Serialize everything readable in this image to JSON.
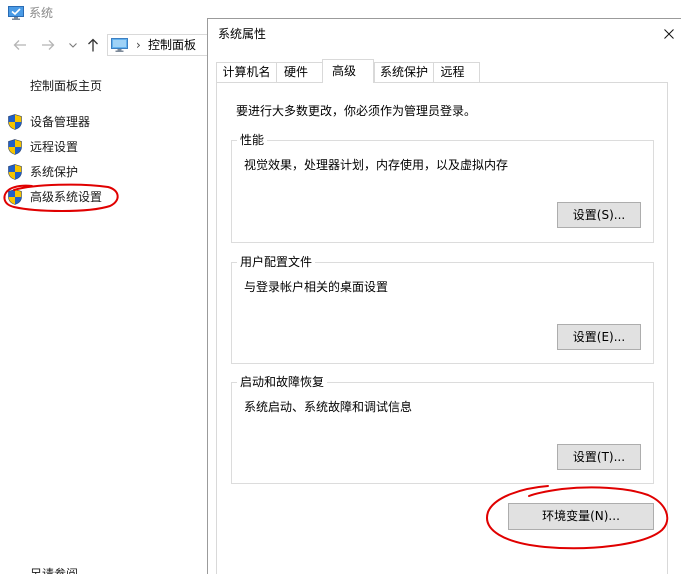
{
  "background_window": {
    "title": "系统",
    "title_icon": "system-monitor-icon",
    "nav": {
      "back_icon": "arrow-left-icon",
      "forward_icon": "arrow-right-icon",
      "recent_icon": "chevron-down-icon",
      "up_icon": "arrow-up-icon"
    },
    "address": {
      "location_icon": "computer-icon",
      "separator": "›",
      "crumb": "控制面板"
    },
    "sidebar": {
      "home_link": "控制面板主页",
      "items": [
        {
          "label": "设备管理器",
          "icon": "uac-shield-icon"
        },
        {
          "label": "远程设置",
          "icon": "uac-shield-icon"
        },
        {
          "label": "系统保护",
          "icon": "uac-shield-icon"
        },
        {
          "label": "高级系统设置",
          "icon": "uac-shield-icon"
        }
      ],
      "see_also": "另请参阅"
    }
  },
  "dialog": {
    "title": "系统属性",
    "close_icon": "close-icon",
    "tabs": [
      {
        "label": "计算机名",
        "selected": false
      },
      {
        "label": "硬件",
        "selected": false
      },
      {
        "label": "高级",
        "selected": true
      },
      {
        "label": "系统保护",
        "selected": false
      },
      {
        "label": "远程",
        "selected": false
      }
    ],
    "advanced": {
      "admin_note": "要进行大多数更改，你必须作为管理员登录。",
      "groups": [
        {
          "title": "性能",
          "description": "视觉效果，处理器计划，内存使用，以及虚拟内存",
          "button": "设置(S)..."
        },
        {
          "title": "用户配置文件",
          "description": "与登录帐户相关的桌面设置",
          "button": "设置(E)..."
        },
        {
          "title": "启动和故障恢复",
          "description": "系统启动、系统故障和调试信息",
          "button": "设置(T)..."
        }
      ],
      "environment_button": "环境变量(N)..."
    }
  },
  "annotations": {
    "color": "#e00000"
  },
  "colors": {
    "shield_blue": "#1f5fc8",
    "shield_yellow": "#f5c400"
  }
}
